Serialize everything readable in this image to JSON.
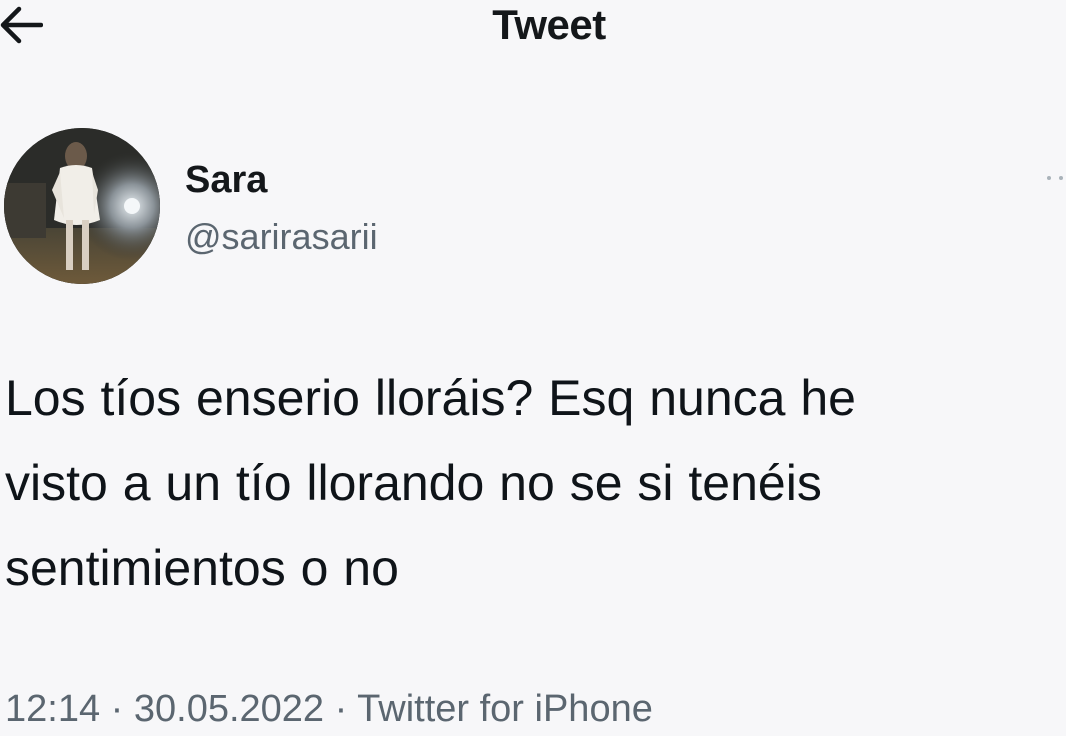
{
  "header": {
    "title": "Tweet",
    "back_icon": "arrow-left-icon"
  },
  "tweet": {
    "author": {
      "name": "Sara",
      "handle": "@sarirasarii",
      "avatar_icon": "avatar-photo"
    },
    "more_icon": "more-options-icon",
    "text": "Los tíos enserio lloráis? Esq nunca he\nvisto a un tío llorando no se si tenéis\nsentimientos o no",
    "time": "12:14",
    "separator": "·",
    "date": "30.05.2022",
    "source": "Twitter for iPhone"
  },
  "colors": {
    "background": "#f7f7f9",
    "text_primary": "#0f1419",
    "text_secondary": "#5b6670"
  }
}
